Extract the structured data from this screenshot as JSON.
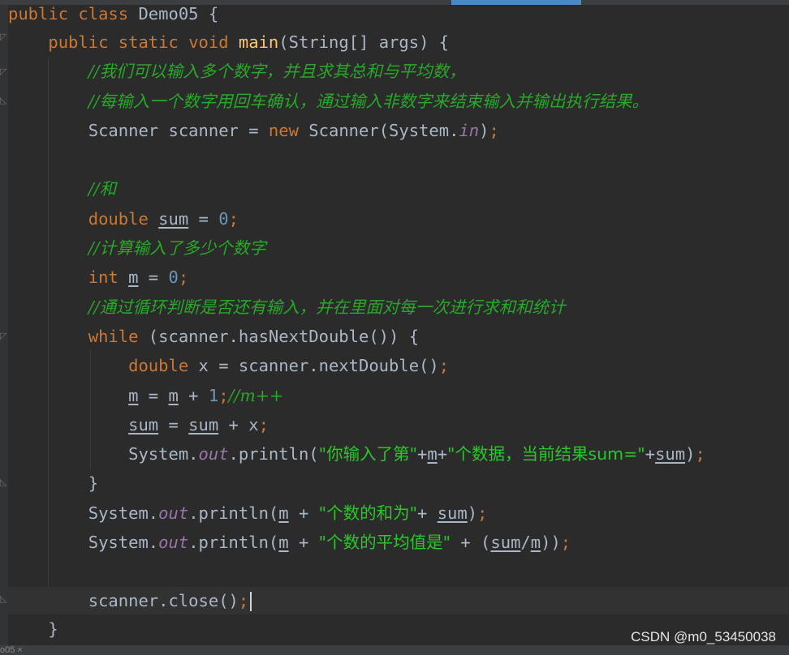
{
  "editor": {
    "lines": {
      "l1": {
        "kw1": "public",
        "kw2": "class",
        "name": "Demo05",
        "brace": " {"
      },
      "l2": {
        "kw1": "public",
        "kw2": "static",
        "kw3": "void",
        "fn": "main",
        "rest": "(String[] args) {"
      },
      "l3": {
        "comment": "//我们可以输入多个数字，并且求其总和与平均数，"
      },
      "l4": {
        "comment": "//每输入一个数字用回车确认，通过输入非数字来结束输入并输出执行结果。"
      },
      "l5": {
        "a": "Scanner scanner = ",
        "kw": "new",
        "b": " Scanner(System.",
        "fld": "in",
        "c": ")",
        "semi": ";"
      },
      "l7": {
        "comment": "//和"
      },
      "l8": {
        "kw": "double",
        "sp": " ",
        "var": "sum",
        "a": " = ",
        "num": "0",
        "semi": ";"
      },
      "l9": {
        "comment": "//计算输入了多少个数字"
      },
      "l10": {
        "kw": "int",
        "sp": " ",
        "var": "m",
        "a": " = ",
        "num": "0",
        "semi": ";"
      },
      "l11": {
        "comment": "//通过循环判断是否还有输入，并在里面对每一次进行求和和统计"
      },
      "l12": {
        "kw": "while",
        "rest": " (scanner.hasNextDouble()) {"
      },
      "l13": {
        "kw": "double",
        "rest": " x = scanner.nextDouble()",
        "semi": ";"
      },
      "l14": {
        "v1": "m",
        "a": " = ",
        "v2": "m",
        "b": " + ",
        "num": "1",
        "semi": ";",
        "comment": "//m++"
      },
      "l15": {
        "v1": "sum",
        "a": " = ",
        "v2": "sum",
        "b": " + x",
        "semi": ";"
      },
      "l16": {
        "a": "System.",
        "fld": "out",
        "b": ".println(",
        "s1": "\"你输入了第\"",
        "c": "+",
        "v1": "m",
        "d": "+",
        "s2": "\"个数据，当前结果sum=\"",
        "e": "+",
        "v2": "sum",
        "f": ")",
        "semi": ";"
      },
      "l17": {
        "brace": "}"
      },
      "l18": {
        "a": "System.",
        "fld": "out",
        "b": ".println(",
        "v1": "m",
        "c": " + ",
        "s1": "\"个数的和为\"",
        "d": "+ ",
        "v2": "sum",
        "e": ")",
        "semi": ";"
      },
      "l19": {
        "a": "System.",
        "fld": "out",
        "b": ".println(",
        "v1": "m",
        "c": " + ",
        "s1": "\"个数的平均值是\"",
        "d": " + (",
        "v2": "sum",
        "e": "/",
        "v3": "m",
        "f": "))",
        "semi": ";"
      },
      "l21": {
        "a": "scanner.close()",
        "semi": ";"
      },
      "l22": {
        "brace": "}"
      }
    }
  },
  "watermark": "CSDN @m0_53450038",
  "status_fragment": "o05 ×",
  "colors": {
    "background": "#2b2b2b",
    "keyword": "#cc7832",
    "method": "#ffc66d",
    "comment": "#28a828",
    "string": "#28c828",
    "number": "#6897bb",
    "field": "#9876aa",
    "text": "#a9b7c6"
  }
}
